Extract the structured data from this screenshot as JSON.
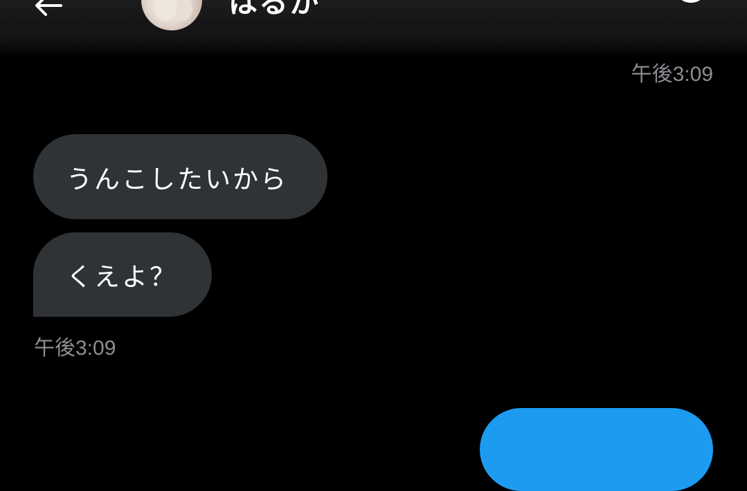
{
  "header": {
    "contact_name": "はるか",
    "back_icon": "arrow-left-icon",
    "info_icon": "info-circle-icon"
  },
  "messages": {
    "outgoing_timestamp": "午後3:09",
    "incoming": [
      {
        "text": "うんこしたいから"
      },
      {
        "text": "くえよ？"
      }
    ],
    "incoming_timestamp": "午後3:09"
  },
  "colors": {
    "background": "#000000",
    "incoming_bubble": "#2f3336",
    "outgoing_bubble": "#1d9bf0",
    "timestamp": "#8b8e92"
  }
}
